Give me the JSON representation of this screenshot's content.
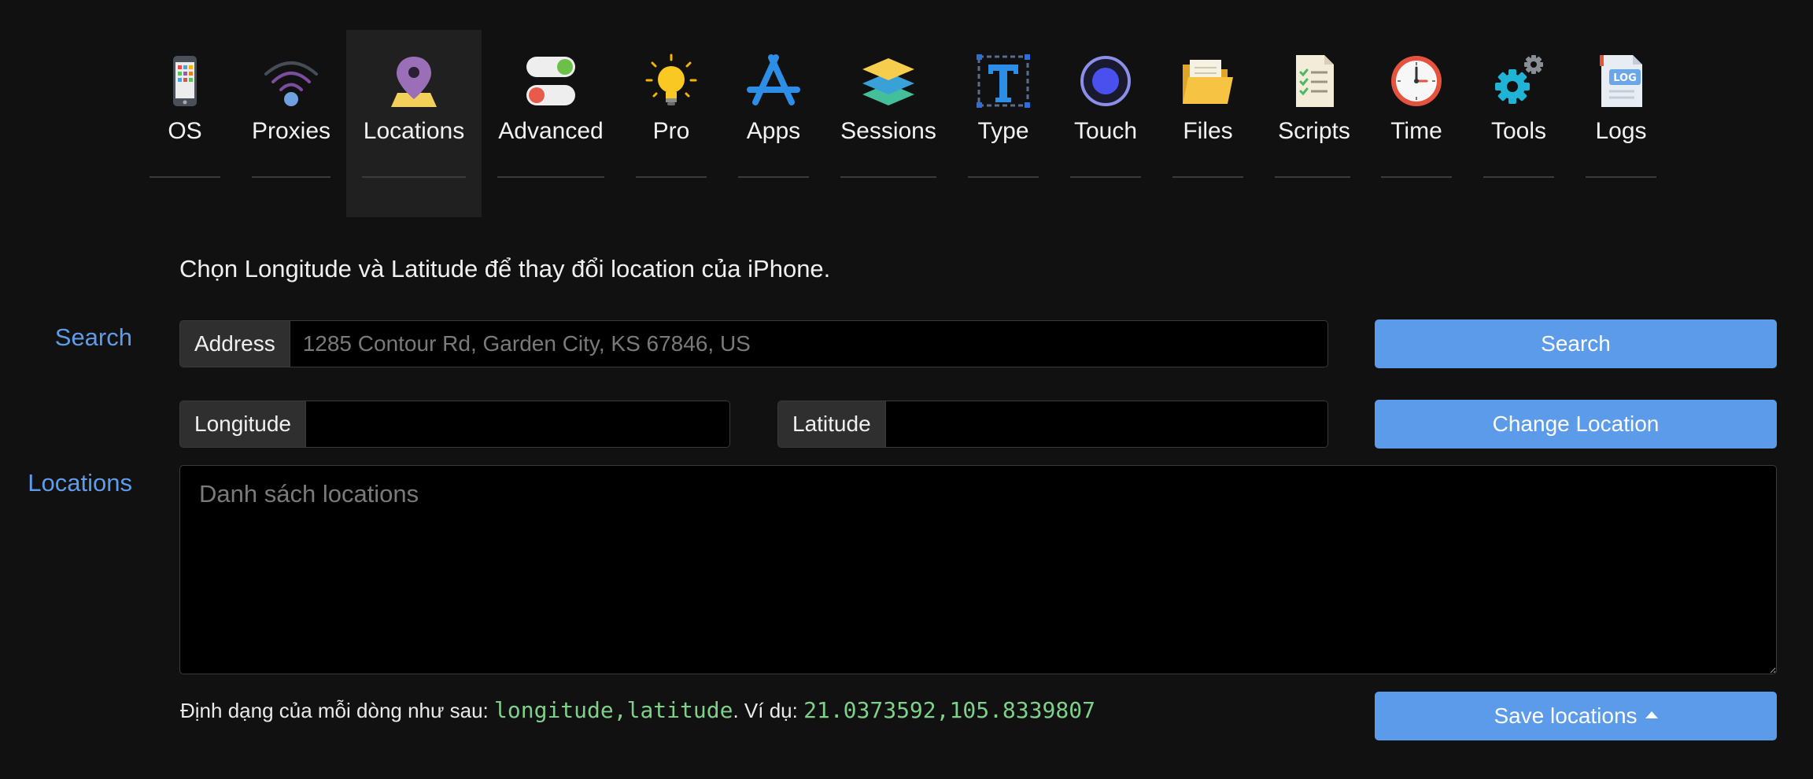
{
  "nav": {
    "items": [
      {
        "label": "OS",
        "icon": "phone-icon"
      },
      {
        "label": "Proxies",
        "icon": "wifi-icon"
      },
      {
        "label": "Locations",
        "icon": "map-pin-icon",
        "active": true
      },
      {
        "label": "Advanced",
        "icon": "toggle-icon"
      },
      {
        "label": "Pro",
        "icon": "lightbulb-icon"
      },
      {
        "label": "Apps",
        "icon": "app-store-icon"
      },
      {
        "label": "Sessions",
        "icon": "layers-icon"
      },
      {
        "label": "Type",
        "icon": "text-type-icon"
      },
      {
        "label": "Touch",
        "icon": "touch-icon"
      },
      {
        "label": "Files",
        "icon": "folder-icon"
      },
      {
        "label": "Scripts",
        "icon": "checklist-icon"
      },
      {
        "label": "Time",
        "icon": "clock-icon"
      },
      {
        "label": "Tools",
        "icon": "gears-icon"
      },
      {
        "label": "Logs",
        "icon": "log-file-icon",
        "badge": "LOG"
      }
    ]
  },
  "intro": "Chọn Longitude và Latitude để thay đổi location của iPhone.",
  "search": {
    "section_label": "Search",
    "address_addon": "Address",
    "address_placeholder": "1285 Contour Rd, Garden City, KS 67846, US",
    "button_label": "Search"
  },
  "coords": {
    "longitude_addon": "Longitude",
    "longitude_value": "",
    "latitude_addon": "Latitude",
    "latitude_value": "",
    "button_label": "Change Location"
  },
  "locations": {
    "section_label": "Locations",
    "placeholder": "Danh sách locations",
    "hint_prefix": "Định dạng của mỗi dòng như sau: ",
    "hint_format": "longitude,latitude",
    "hint_middle": ". Ví dụ: ",
    "hint_example": "21.0373592,105.8339807",
    "save_label": "Save locations"
  },
  "colors": {
    "accent": "#5b9bea",
    "background": "#111111",
    "code_green": "#7fd08a"
  }
}
